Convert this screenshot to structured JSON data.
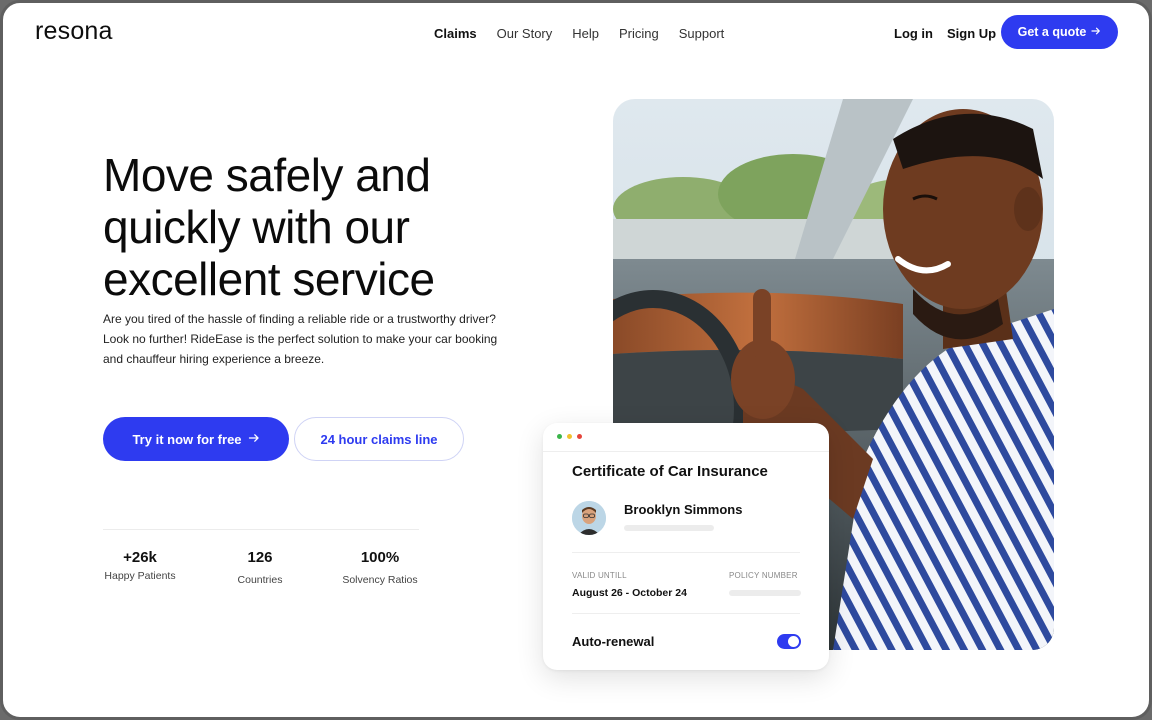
{
  "header": {
    "logo": "resona",
    "nav": [
      "Claims",
      "Our Story",
      "Help",
      "Pricing",
      "Support"
    ],
    "active_nav": "Claims",
    "login": "Log in",
    "signup": "Sign Up",
    "quote_button": "Get a quote",
    "quote_icon": "arrow-right-icon"
  },
  "hero": {
    "title": "Move safely and quickly with our excellent service",
    "description": "Are you tired of the hassle of finding a reliable ride or a trustworthy driver? Look no further! RideEase is the perfect solution to make your car booking and chauffeur hiring experience a breeze.",
    "primary_button": "Try it now for free",
    "primary_icon": "arrow-right-icon",
    "secondary_button": "24 hour claims line"
  },
  "stats": [
    {
      "value": "+26k",
      "label": "Happy Patients"
    },
    {
      "value": "126",
      "label": "Countries"
    },
    {
      "value": "100%",
      "label": "Solvency Ratios"
    }
  ],
  "card": {
    "title": "Certificate of Car Insurance",
    "holder_name": "Brooklyn Simmons",
    "valid_label": "VALID UNTILL",
    "valid_value": "August 26 - October 24",
    "policy_label": "POLICY NUMBER",
    "auto_renewal_label": "Auto-renewal",
    "auto_renewal_on": true
  },
  "colors": {
    "accent": "#2e3bf0",
    "dot_green": "#3bb54a",
    "dot_yellow": "#f2c12e",
    "dot_red": "#e5443b"
  }
}
